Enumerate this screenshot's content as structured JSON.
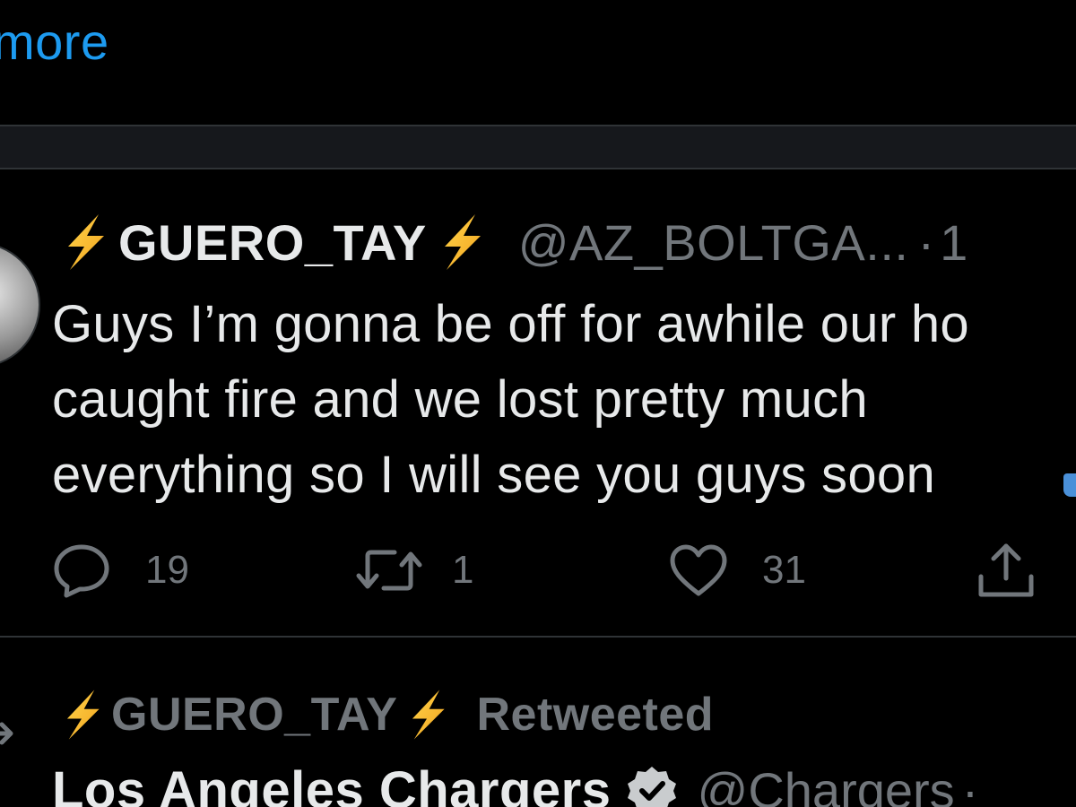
{
  "show_more": {
    "label": "more"
  },
  "tweet": {
    "display_name": "GUERO_TAY",
    "handle": "@AZ_BOLTGA...",
    "separator": "·",
    "time": "1",
    "text_lines": [
      "Guys I’m gonna be off for awhile our ho",
      "caught fire and we lost pretty much",
      "everything so I will see you guys soon"
    ],
    "actions": {
      "reply_count": "19",
      "retweet_count": "1",
      "like_count": "31"
    }
  },
  "retweet_banner": {
    "name": "GUERO_TAY",
    "label": "Retweeted"
  },
  "next_tweet": {
    "display_name": "Los Angeles Chargers",
    "handle": "@Chargers",
    "separator": "·"
  },
  "colors": {
    "background": "#000000",
    "link": "#1d9bf0",
    "primary_text": "#e7e9ea",
    "secondary_text": "#71767b",
    "divider": "#2f3336",
    "bolt": "#f5b82e"
  },
  "icons": [
    "lightning-bolt-icon",
    "reply-icon",
    "retweet-icon",
    "like-icon",
    "share-icon",
    "verified-icon"
  ]
}
